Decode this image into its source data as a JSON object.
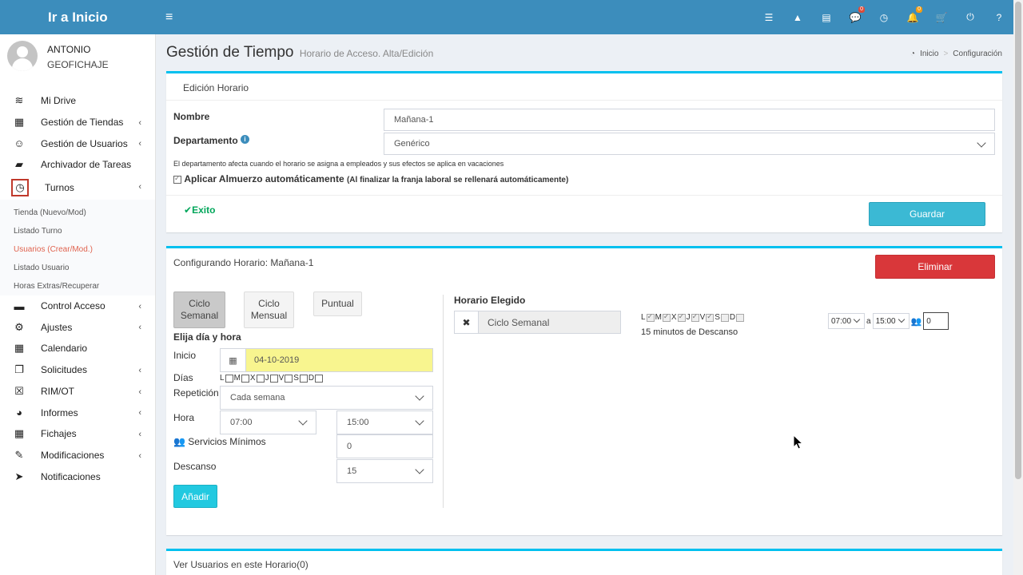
{
  "header": {
    "logo_text": "Ir a Inicio",
    "hamburger_icon": "≡",
    "icons": [
      {
        "name": "list-icon",
        "glyph": "☰",
        "badge": ""
      },
      {
        "name": "road-icon",
        "glyph": "▲",
        "badge": ""
      },
      {
        "name": "card-icon",
        "glyph": "▤",
        "badge": ""
      },
      {
        "name": "chat-icon",
        "glyph": "💬",
        "badge": "0",
        "badge_color": "#dd4b39"
      },
      {
        "name": "clock-icon",
        "glyph": "◷",
        "badge": ""
      },
      {
        "name": "bell-icon",
        "glyph": "🔔",
        "badge": "0",
        "badge_color": "#f39c12"
      },
      {
        "name": "cart-icon",
        "glyph": "🛒",
        "badge": ""
      },
      {
        "name": "power-icon",
        "glyph": "⏻",
        "badge": ""
      },
      {
        "name": "help-icon",
        "glyph": "?",
        "badge": ""
      }
    ]
  },
  "user": {
    "name": "ANTONIO",
    "company": "GEOFICHAJE"
  },
  "sidebar": {
    "items_top": [
      {
        "label": "Mi Drive",
        "icon": "database-icon",
        "glyph": "≋",
        "chevron": false
      },
      {
        "label": "Gestión de Tiendas",
        "icon": "building-icon",
        "glyph": "▦",
        "chevron": true
      },
      {
        "label": "Gestión de Usuarios",
        "icon": "smiley-icon",
        "glyph": "☺",
        "chevron": true
      },
      {
        "label": "Archivador de Tareas",
        "icon": "book-icon",
        "glyph": "▰",
        "chevron": false
      }
    ],
    "turnos": {
      "label": "Turnos",
      "icon": "clock-icon",
      "glyph": "◷"
    },
    "submenu": [
      {
        "label": "Tienda (Nuevo/Mod)",
        "active": false
      },
      {
        "label": "Listado Turno",
        "active": false
      },
      {
        "label": "Usuarios (Crear/Mod.)",
        "active": true
      },
      {
        "label": "Listado Usuario",
        "active": false
      },
      {
        "label": "Horas Extras/Recuperar",
        "active": false
      }
    ],
    "items_bottom": [
      {
        "label": "Control Acceso",
        "icon": "credit-card-icon",
        "glyph": "▬",
        "chevron": true
      },
      {
        "label": "Ajustes",
        "icon": "gear-icon",
        "glyph": "⚙",
        "chevron": true
      },
      {
        "label": "Calendario",
        "icon": "calendar-icon",
        "glyph": "▦",
        "chevron": false
      },
      {
        "label": "Solicitudes",
        "icon": "clone-icon",
        "glyph": "❐",
        "chevron": true
      },
      {
        "label": "RIM/OT",
        "icon": "calendar-x-icon",
        "glyph": "☒",
        "chevron": true
      },
      {
        "label": "Informes",
        "icon": "pie-chart-icon",
        "glyph": "◕",
        "chevron": true
      },
      {
        "label": "Fichajes",
        "icon": "grid-icon",
        "glyph": "▦",
        "chevron": true
      },
      {
        "label": "Modificaciones",
        "icon": "edit-icon",
        "glyph": "✎",
        "chevron": true
      },
      {
        "label": "Notificaciones",
        "icon": "paper-plane-icon",
        "glyph": "➤",
        "chevron": false
      }
    ]
  },
  "page": {
    "title": "Gestión de Tiempo",
    "subtitle": "Horario de Acceso. Alta/Edición",
    "breadcrumb": [
      "Inicio",
      "Configuración"
    ]
  },
  "edicion": {
    "title": "Edición Horario",
    "nombre_label": "Nombre",
    "nombre_value": "Mañana-1",
    "departamento_label": "Departamento",
    "departamento_value": "Genérico",
    "note": "El departamento afecta cuando el horario se asigna a empleados y sus efectos se aplica en vacaciones",
    "almuerzo_label": "Aplicar Almuerzo automáticamente",
    "almuerzo_note": "(Al finalizar la franja laboral se rellenará automáticamente)",
    "status": "Exito",
    "guardar": "Guardar"
  },
  "config": {
    "title": "Configurando Horario: Mañana-1",
    "eliminar": "Eliminar",
    "tabs": [
      "Ciclo\nSemanal",
      "Ciclo\nMensual",
      "Puntual"
    ],
    "elija_label": "Elija día y hora",
    "inicio_label": "Inicio",
    "inicio_value": "04-10-2019",
    "dias_label": "Días",
    "days": [
      "L",
      "M",
      "X",
      "J",
      "V",
      "S",
      "D"
    ],
    "repeticion_label": "Repetición",
    "repeticion_value": "Cada semana",
    "hora_label": "Hora",
    "hora_desde": "07:00",
    "hora_hasta": "15:00",
    "servicios_label": "Servicios Mínimos",
    "servicios_value": "0",
    "descanso_label": "Descanso",
    "descanso_value": "15",
    "anadir": "Añadir",
    "elegido_title": "Horario Elegido",
    "elegido_tipo": "Ciclo Semanal",
    "elegido_days": [
      "L",
      "M",
      "X",
      "J",
      "V",
      "S",
      "D"
    ],
    "elegido_descanso": "15 minutos de Descanso",
    "elegido_desde": "07:00",
    "elegido_a": "a",
    "elegido_hasta": "15:00",
    "elegido_servicios": "0"
  },
  "usuarios": {
    "title": "Ver Usuarios en este Horario(0)"
  }
}
